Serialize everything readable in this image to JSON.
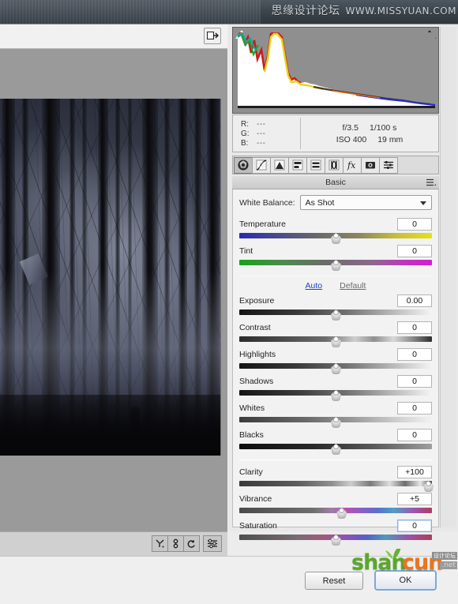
{
  "watermarks": {
    "top_cn": "思缘设计论坛",
    "top_url": "WWW.MISSYUAN.COM",
    "bottom_green": "shan",
    "bottom_orange": "cun",
    "bottom_tld": ".net",
    "bottom_cn": "设计论坛"
  },
  "preview": {
    "expand_icon": "expand-panel-icon",
    "tools": [
      {
        "name": "white-balance-tool-icon",
        "glyph": "Y"
      },
      {
        "name": "color-sampler-icon",
        "glyph": "S"
      },
      {
        "name": "rotate-left-icon",
        "glyph": "R"
      },
      {
        "name": "preferences-icon",
        "glyph": "P"
      }
    ]
  },
  "histogram": {
    "clip_shadow_indicator": "shadow-clipping-icon",
    "clip_highlight_indicator": "highlight-clipping-icon"
  },
  "readout": {
    "channels": [
      {
        "label": "R:",
        "value": "---"
      },
      {
        "label": "G:",
        "value": "---"
      },
      {
        "label": "B:",
        "value": "---"
      }
    ],
    "exif": {
      "aperture": "f/3.5",
      "shutter": "1/100 s",
      "iso": "ISO 400",
      "focal_length": "19 mm"
    }
  },
  "panel_tabs": [
    {
      "name": "tab-basic",
      "icon": "aperture-icon",
      "active": true
    },
    {
      "name": "tab-tone-curve",
      "icon": "curve-icon",
      "active": false
    },
    {
      "name": "tab-detail",
      "icon": "triangle-detail-icon",
      "active": false
    },
    {
      "name": "tab-hsl-grayscale",
      "icon": "hsl-icon",
      "active": false
    },
    {
      "name": "tab-split-toning",
      "icon": "split-toning-icon",
      "active": false
    },
    {
      "name": "tab-lens-corrections",
      "icon": "lens-icon",
      "active": false
    },
    {
      "name": "tab-effects",
      "icon": "fx-icon",
      "active": false
    },
    {
      "name": "tab-camera-calibration",
      "icon": "camera-icon",
      "active": false
    },
    {
      "name": "tab-presets",
      "icon": "presets-icon",
      "active": false
    }
  ],
  "panel": {
    "title": "Basic",
    "menu_icon": "panel-menu-icon",
    "white_balance_label": "White Balance:",
    "white_balance_value": "As Shot",
    "auto_label": "Auto",
    "default_label": "Default",
    "accent_link_color": "#1b44c8"
  },
  "sliders": {
    "temperature": {
      "label": "Temperature",
      "value": "0",
      "pos": 50
    },
    "tint": {
      "label": "Tint",
      "value": "0",
      "pos": 50
    },
    "exposure": {
      "label": "Exposure",
      "value": "0.00",
      "pos": 50
    },
    "contrast": {
      "label": "Contrast",
      "value": "0",
      "pos": 50
    },
    "highlights": {
      "label": "Highlights",
      "value": "0",
      "pos": 50
    },
    "shadows": {
      "label": "Shadows",
      "value": "0",
      "pos": 50
    },
    "whites": {
      "label": "Whites",
      "value": "0",
      "pos": 50
    },
    "blacks": {
      "label": "Blacks",
      "value": "0",
      "pos": 50
    },
    "clarity": {
      "label": "Clarity",
      "value": "+100",
      "pos": 98
    },
    "vibrance": {
      "label": "Vibrance",
      "value": "+5",
      "pos": 53
    },
    "saturation": {
      "label": "Saturation",
      "value": "0",
      "pos": 50
    }
  },
  "footer": {
    "reset_label": "Reset",
    "ok_label": "OK"
  }
}
